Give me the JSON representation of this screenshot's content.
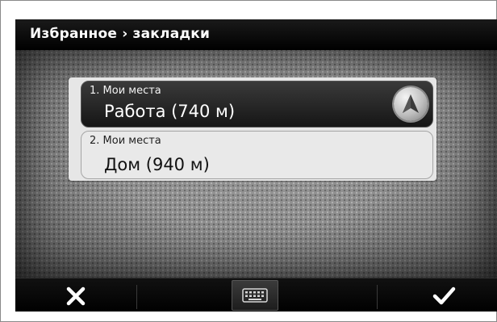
{
  "header": {
    "title": "Избранное › закладки"
  },
  "favorites": {
    "items": [
      {
        "label": "1. Мои места",
        "name": "Работа (740 м)",
        "selected": true
      },
      {
        "label": "2. Мои места",
        "name": "Дом (940 м)",
        "selected": false
      }
    ]
  },
  "toolbar": {
    "cancel_icon": "close-icon",
    "keyboard_icon": "keyboard-icon",
    "confirm_icon": "checkmark-icon"
  },
  "colors": {
    "title_bar": "#000000",
    "selected_item": "#1f1f1f",
    "panel": "#e6e6e6"
  }
}
